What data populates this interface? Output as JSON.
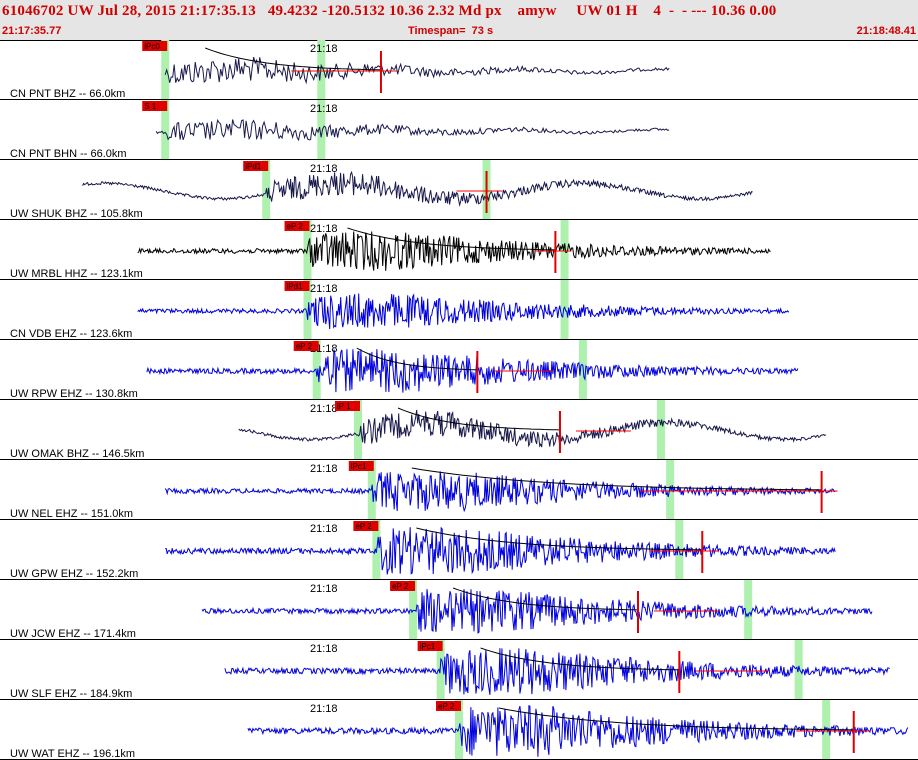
{
  "header": {
    "title": "61046702 UW Jul 28, 2015 21:17:35.13   49.4232 -120.5132 10.36 2.32 Md px    amyw     UW 01 H    4  -  - --- 10.36 0.00",
    "start_time": "21:17:35.77",
    "timespan": "Timespan=  73 s",
    "end_time": "21:18:48.41"
  },
  "time_marker_label": "21:18",
  "colors": {
    "header_bg": "#e5e5e5",
    "header_text": "#d00000",
    "trace_dark": "#1a1a4d",
    "trace_black": "#000000",
    "trace_blue": "#0000dd",
    "pick_flag": "#e00000",
    "pick_bar": "#aef0ae",
    "coda_curve": "#000000",
    "residual_line": "#ff0000"
  },
  "panels": [
    {
      "label": "CN PNT BHZ -- 66.0km",
      "pick": "iPc0",
      "style": "dark",
      "wave": "long",
      "amp": 16,
      "t0": 0.18,
      "t1": 0.73,
      "p": 0.18,
      "s": 0.35,
      "mark": 0.415,
      "coda": true
    },
    {
      "label": "CN PNT BHN -- 66.0km",
      "pick": "S 1",
      "style": "dark",
      "wave": "long",
      "amp": 13,
      "t0": 0.17,
      "t1": 0.73,
      "p": 0.18,
      "s": 0.35,
      "mark": null,
      "coda": false
    },
    {
      "label": "UW SHUK BHZ -- 105.8km",
      "pick": "iPd1",
      "style": "dark",
      "wave": "swell",
      "amp": 22,
      "t0": 0.09,
      "t1": 0.82,
      "p": 0.29,
      "s": 0.53,
      "mark": 0.53,
      "coda": false
    },
    {
      "label": "UW MRBL HHZ -- 123.1km",
      "pick": "eP 2",
      "style": "black",
      "wave": "short",
      "amp": 20,
      "t0": 0.15,
      "t1": 0.84,
      "p": 0.335,
      "s": 0.615,
      "mark": 0.605,
      "coda": true
    },
    {
      "label": "CN VDB EHZ -- 123.6km",
      "pick": "iPd1",
      "style": "blue",
      "wave": "short",
      "amp": 18,
      "t0": 0.15,
      "t1": 0.86,
      "p": 0.335,
      "s": 0.615,
      "mark": null,
      "coda": false
    },
    {
      "label": "UW RPW EHZ -- 130.8km",
      "pick": "eP 2",
      "style": "blue",
      "wave": "short",
      "amp": 22,
      "t0": 0.16,
      "t1": 0.87,
      "p": 0.345,
      "s": 0.635,
      "mark": 0.52,
      "coda": true
    },
    {
      "label": "UW OMAK BHZ -- 146.5km",
      "pick": "iP 1",
      "style": "dark",
      "wave": "swell",
      "amp": 24,
      "t0": 0.26,
      "t1": 0.9,
      "p": 0.39,
      "s": 0.72,
      "mark": 0.61,
      "coda": true
    },
    {
      "label": "UW NEL EHZ -- 151.0km",
      "pick": "iPc1",
      "style": "blue",
      "wave": "short",
      "amp": 20,
      "t0": 0.18,
      "t1": 0.91,
      "p": 0.405,
      "s": 0.73,
      "mark": 0.895,
      "coda": true
    },
    {
      "label": "UW GPW EHZ -- 152.2km",
      "pick": "eP 2",
      "style": "blue",
      "wave": "short",
      "amp": 24,
      "t0": 0.18,
      "t1": 0.91,
      "p": 0.41,
      "s": 0.74,
      "mark": 0.765,
      "coda": true
    },
    {
      "label": "UW JCW EHZ -- 171.4km",
      "pick": "eP 2",
      "style": "blue",
      "wave": "short",
      "amp": 22,
      "t0": 0.22,
      "t1": 0.95,
      "p": 0.45,
      "s": 0.815,
      "mark": 0.695,
      "coda": true
    },
    {
      "label": "UW SLF EHZ -- 184.9km",
      "pick": "iPc1",
      "style": "blue",
      "wave": "short",
      "amp": 24,
      "t0": 0.245,
      "t1": 0.97,
      "p": 0.48,
      "s": 0.87,
      "mark": 0.74,
      "coda": true
    },
    {
      "label": "UW WAT EHZ -- 196.1km",
      "pick": "eP 2",
      "style": "blue",
      "wave": "short",
      "amp": 26,
      "t0": 0.27,
      "t1": 0.99,
      "p": 0.5,
      "s": 0.9,
      "mark": 0.93,
      "coda": true
    }
  ]
}
